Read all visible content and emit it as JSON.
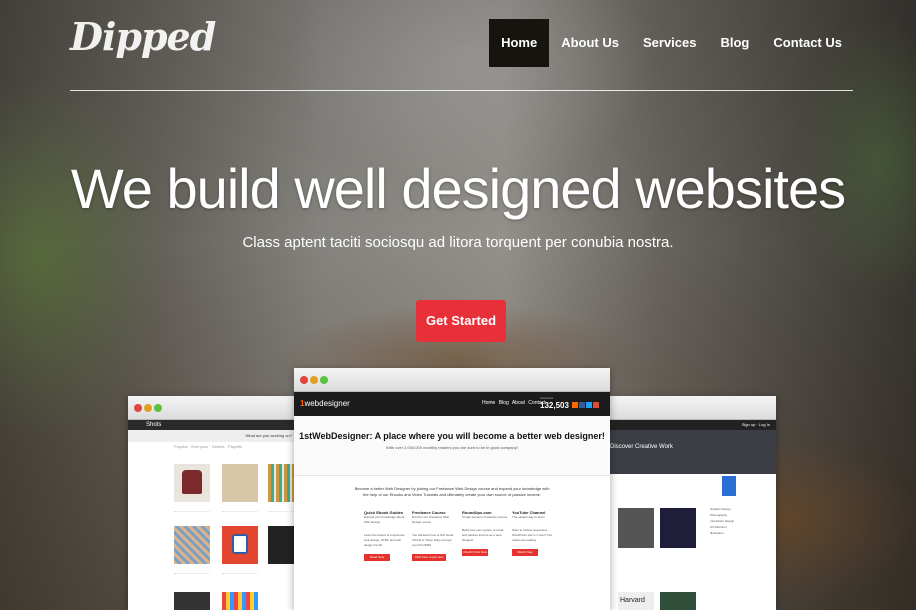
{
  "brand": {
    "logo_text": "Dipped"
  },
  "nav": {
    "items": [
      {
        "label": "Home",
        "active": true
      },
      {
        "label": "About Us",
        "active": false
      },
      {
        "label": "Services",
        "active": false
      },
      {
        "label": "Blog",
        "active": false
      },
      {
        "label": "Contact Us",
        "active": false
      }
    ]
  },
  "hero": {
    "title": "We build well designed websites",
    "subtitle": "Class aptent taciti sociosqu ad litora torquent per conubia nostra.",
    "cta_label": "Get Started",
    "cta_color": "#e8303a"
  },
  "showcase": {
    "left": {
      "header_text": "Shots",
      "banner_text": "What are you working on?",
      "tabs_text": "Popular · Everyone · Debuts · Playoffs"
    },
    "center": {
      "logo_prefix": "1",
      "logo_text": "webdesigner",
      "nav_text": "Home Blog About Contact",
      "counter_label": "Subscribe",
      "counter_value": "132,503",
      "headline": "1stWebDesigner: A place where you will become a better web designer!",
      "subhead": "With over 2,000,000 monthly readers you are sure to be in good company!",
      "intro": "Become a better Web Designer by joining our Freelance Web Design course and expand your knowledge with the help of our Ebooks and Video Tutorials and ultimately create your own source of passive income.",
      "columns": [
        {
          "title": "Quick Ebook Guides",
          "text": "Expand your knowledge about Web Design",
          "body": "Learn the basics of responsive web design, HTML and web design trends",
          "button": "Read Now"
        },
        {
          "title": "Freelance Course",
          "text": "Enroll in our Freelance Web Design course",
          "body": "You will learn how to find Great Clients in Three Days and get your first $300",
          "button": "Click here to join now"
        },
        {
          "title": "RoundUps.com",
          "text": "Create streams of passive income",
          "body": "Build your own system of small and passive income as a web designer",
          "button": "Check It Out Now"
        },
        {
          "title": "YouTube Channel",
          "text": "The easiest way to learn",
          "body": "Want to build a responsive WordPress site in 1 hour? Our videos are waiting",
          "button": "Watch Now"
        }
      ]
    },
    "right": {
      "top_text": "Sign up · Log In",
      "hero_text": "Discover Creative Work",
      "side_items": [
        "Graphic Design",
        "Photography",
        "Interaction Design",
        "Art Direction",
        "Illustration"
      ],
      "tile_text": "Harvard"
    }
  }
}
